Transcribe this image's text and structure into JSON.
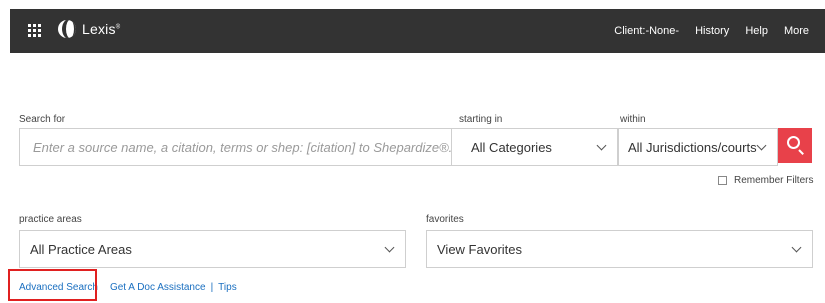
{
  "header": {
    "brand": "Lexis",
    "brand_mark": "®",
    "nav": [
      "Client:-None-",
      "History",
      "Help",
      "More"
    ]
  },
  "search": {
    "label": "Search for",
    "placeholder": "Enter a source name, a citation, terms or shep: [citation] to Shepardize®."
  },
  "starting_in": {
    "label": "starting in",
    "value": "All Categories"
  },
  "within": {
    "label": "within",
    "value": "All Jurisdictions/courts"
  },
  "remember_filters": {
    "label": "Remember Filters",
    "checked": false
  },
  "practice_areas": {
    "label": "practice areas",
    "value": "All Practice Areas"
  },
  "favorites": {
    "label": "favorites",
    "value": "View Favorites"
  },
  "links": {
    "advanced_search": "Advanced Search",
    "get_a_doc": "Get A Doc Assistance",
    "separator": "|",
    "tips": "Tips"
  },
  "colors": {
    "topbar": "#333333",
    "accent": "#e8414a",
    "link": "#1a6fc0",
    "highlight_border": "#e02020"
  }
}
